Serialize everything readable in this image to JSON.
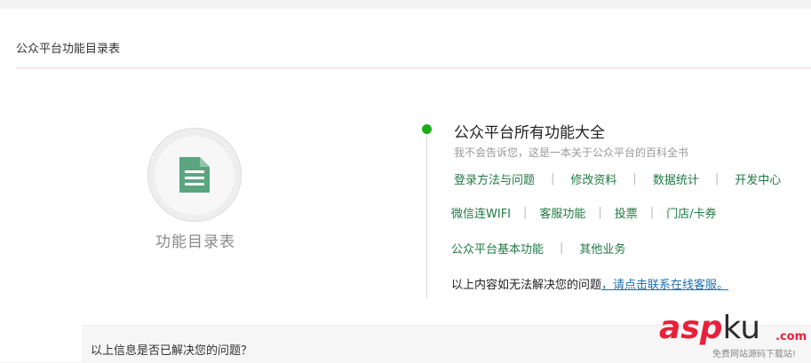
{
  "header": {
    "title": "公众平台功能目录表"
  },
  "catalog": {
    "label": "功能目录表",
    "icon": "document-icon"
  },
  "section": {
    "title": "公众平台所有功能大全",
    "subtitle": "我不会告诉您，这是一本关于公众平台的百科全书",
    "rows": [
      [
        "登录方法与问题",
        "修改资料",
        "数据统计",
        "开发中心"
      ],
      [
        "微信连WIFI",
        "客服功能",
        "投票",
        "门店/卡券"
      ],
      [
        "公众平台基本功能",
        "其他业务"
      ]
    ],
    "separator": "|",
    "help_text": "以上内容如无法解决您的问题",
    "help_link": "，请点击联系在线客服。"
  },
  "feedback": {
    "question": "以上信息是否已解决您的问题？"
  },
  "watermark": {
    "brand_a": "asp",
    "brand_b": "ku",
    "brand_c": ".com",
    "tagline": "免费网站源码下载站!"
  },
  "colors": {
    "accent_green": "#1aad19",
    "link_green": "#1f7a43",
    "link_blue": "#1e6fb0",
    "icon_teal": "#5aa57f"
  }
}
